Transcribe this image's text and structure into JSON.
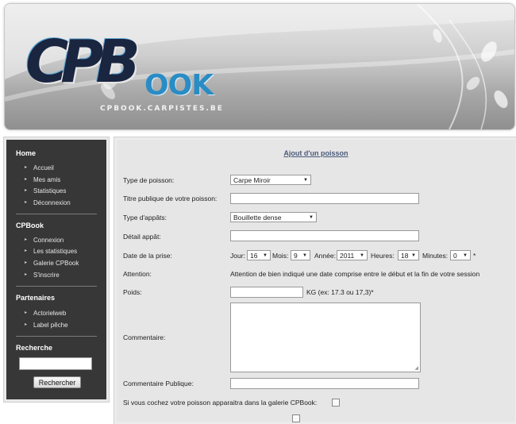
{
  "banner": {
    "logo_main": "CPB",
    "logo_secondary": "OOK",
    "url": "CPBOOK.CARPISTES.BE"
  },
  "sidebar": {
    "sections": [
      {
        "title": "Home",
        "items": [
          "Accueil",
          "Mes amis",
          "Statistiques",
          "Déconnexion"
        ]
      },
      {
        "title": "CPBook",
        "items": [
          "Connexion",
          "Les statistiques",
          "Galerie CPBook",
          "S'inscrire"
        ]
      },
      {
        "title": "Partenaires",
        "items": [
          "Actorielweb",
          "Label pêche"
        ]
      }
    ],
    "search": {
      "title": "Recherche",
      "button": "Rechercher",
      "value": ""
    }
  },
  "form": {
    "title": "Ajout d'un poisson",
    "fish_type_label": "Type de poisson:",
    "fish_type_value": "Carpe Miroir",
    "public_title_label": "Titre publique de votre poisson:",
    "bait_type_label": "Type d'appâts:",
    "bait_type_value": "Bouillette dense",
    "bait_detail_label": "Détail appât:",
    "date_label": "Date de la prise:",
    "jour_label": "Jour:",
    "jour_value": "16",
    "mois_label": "Mois:",
    "mois_value": "9",
    "annee_label": "Année:",
    "annee_value": "2011",
    "heures_label": "Heures:",
    "heures_value": "18",
    "minutes_label": "Minutes:",
    "minutes_value": "0",
    "required_mark": "*",
    "attention_label": "Attention:",
    "attention_text": "Attention de bien indiqué une date comprise entre le début et la fin de votre session",
    "poids_label": "Poids:",
    "poids_hint": "KG (ex: 17.3 ou 17,3)*",
    "comment_label": "Commentaire:",
    "public_comment_label": "Commentaire Publique:",
    "gallery_label": "Si vous cochez votre poisson apparaitra dans la galerie CPBook:"
  }
}
